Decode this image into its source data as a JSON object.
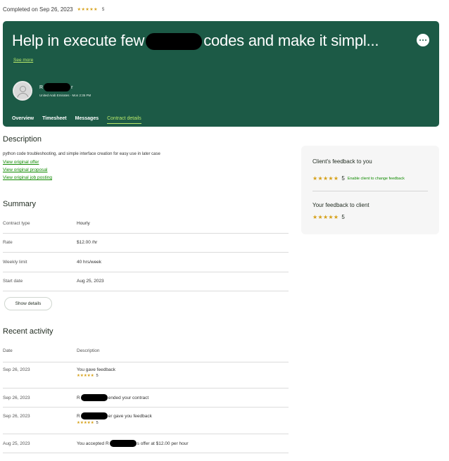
{
  "header": {
    "completed_text": "Completed on Sep 26, 2023",
    "rating_stars": "★★★★★",
    "rating_value": "5"
  },
  "banner": {
    "title_before": "Help in execute few",
    "title_after": "codes and make it simpl...",
    "see_more": "See more",
    "client_name_start": "R",
    "client_name_end": "r",
    "client_meta": "United Arab Emirates · Mon 2:35 PM",
    "tabs": [
      {
        "label": "Overview"
      },
      {
        "label": "Timesheet"
      },
      {
        "label": "Messages"
      },
      {
        "label": "Contract details"
      }
    ]
  },
  "description": {
    "title": "Description",
    "text": "python code troubleshooting, and simple interface creation for easy use in later case",
    "links": [
      "View original offer",
      "View original proposal",
      "View original job posting"
    ]
  },
  "summary": {
    "title": "Summary",
    "rows": [
      {
        "label": "Contract type",
        "value": "Hourly"
      },
      {
        "label": "Rate",
        "value": "$12.00 /hr"
      },
      {
        "label": "Weekly limit",
        "value": "40 hrs/week"
      },
      {
        "label": "Start date",
        "value": "Aug 25, 2023"
      }
    ],
    "show_details": "Show details"
  },
  "activity": {
    "title": "Recent activity",
    "col_date": "Date",
    "col_desc": "Description",
    "rows": [
      {
        "date": "Sep 26, 2023",
        "before": "You gave feedback",
        "after": "",
        "stars": "★★★★★",
        "rating": "5"
      },
      {
        "date": "Sep 26, 2023",
        "before": "R",
        "after": "ended your contract",
        "stars": "",
        "rating": ""
      },
      {
        "date": "Sep 26, 2023",
        "before": "R",
        "after": "er gave you feedback",
        "stars": "★★★★★",
        "rating": "5"
      },
      {
        "date": "Aug 25, 2023",
        "before": "You accepted R",
        "after": "s offer at $12.00 per hour",
        "stars": "",
        "rating": ""
      }
    ]
  },
  "feedback": {
    "client_title": "Client's feedback to you",
    "client_stars": "★★★★★",
    "client_rating": "5",
    "client_link": "Enable client to change feedback",
    "your_title": "Your feedback to client",
    "your_stars": "★★★★★",
    "your_rating": "5"
  },
  "colors": {
    "banner": "#1c5a46",
    "accent": "#b7e86a",
    "star": "#d6a018",
    "link": "#108a00"
  }
}
